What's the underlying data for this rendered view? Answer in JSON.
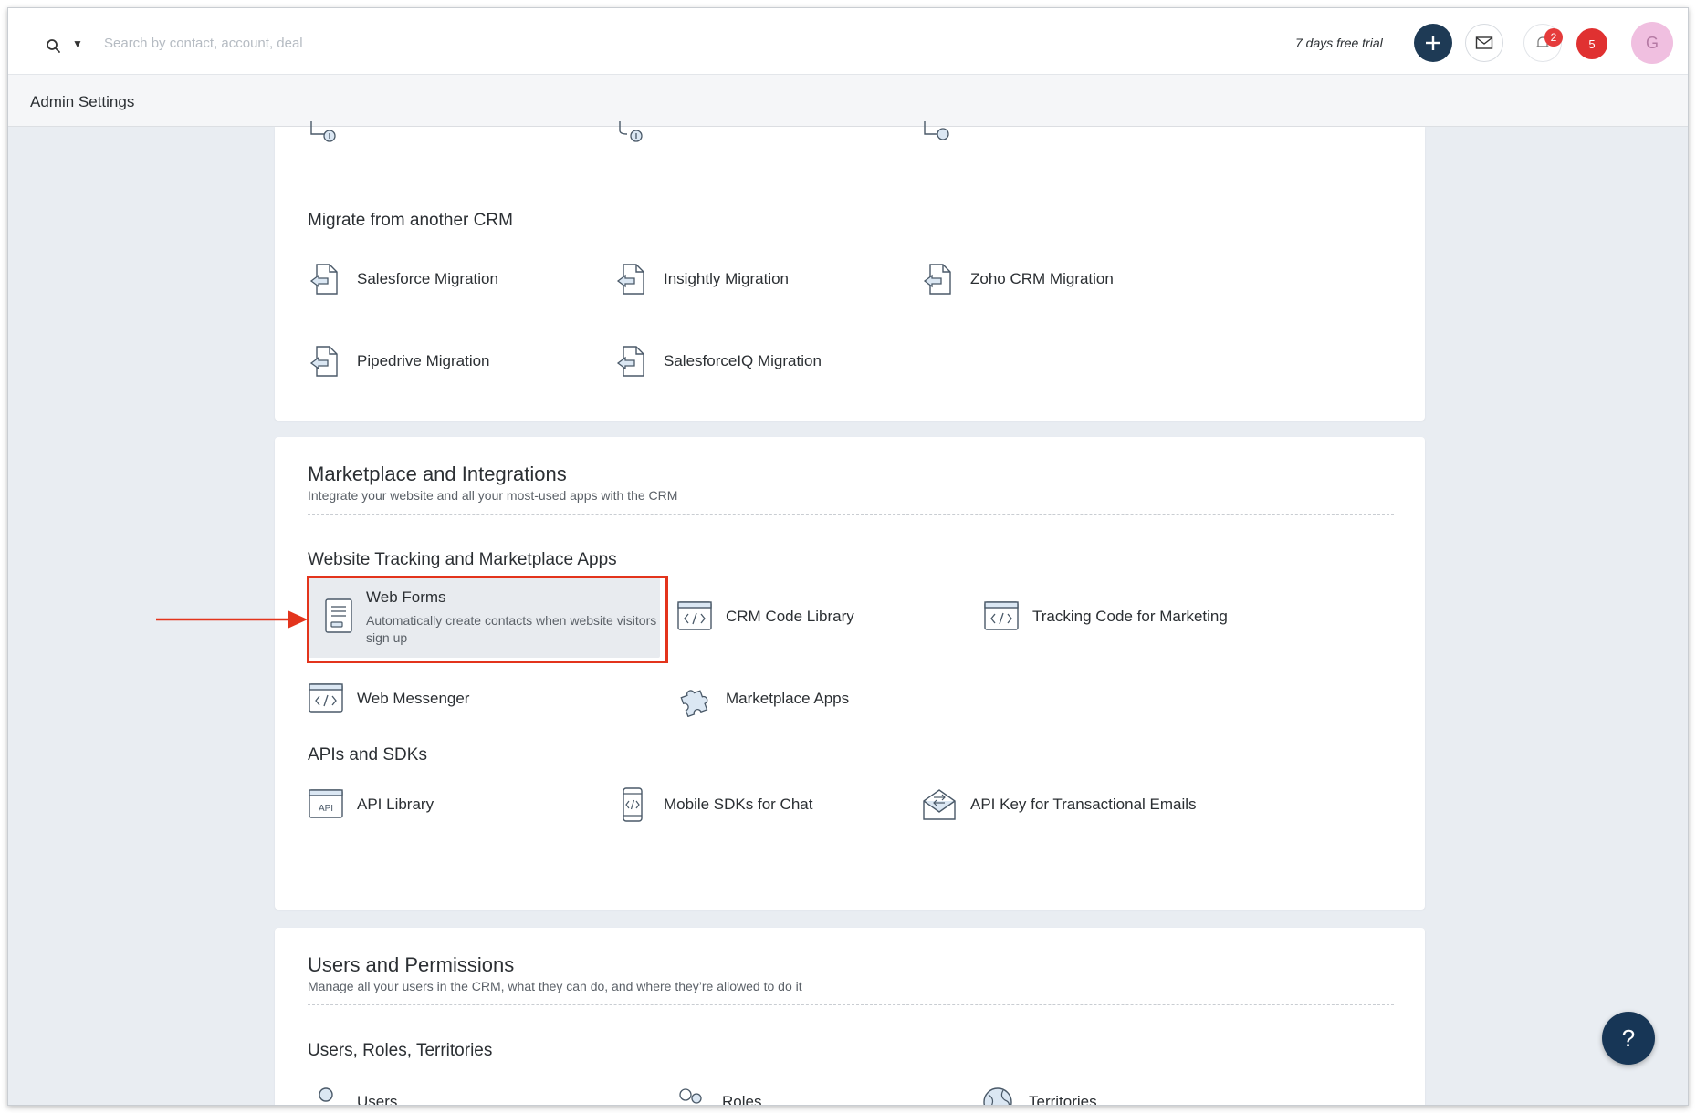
{
  "header": {
    "search_placeholder": "Search by contact, account, deal",
    "trial_text": "7 days free trial",
    "notification_count": "2",
    "alert_count": "5",
    "avatar_initial": "G"
  },
  "subbar": {
    "title": "Admin Settings"
  },
  "migrate": {
    "title": "Migrate from another CRM",
    "items": [
      {
        "label": "Salesforce Migration",
        "icon": "file-import-icon"
      },
      {
        "label": "Insightly Migration",
        "icon": "file-import-icon"
      },
      {
        "label": "Zoho CRM Migration",
        "icon": "file-import-icon"
      },
      {
        "label": "Pipedrive Migration",
        "icon": "file-import-icon"
      },
      {
        "label": "SalesforceIQ Migration",
        "icon": "file-import-icon"
      }
    ]
  },
  "marketplace": {
    "title": "Marketplace and Integrations",
    "description": "Integrate your website and all your most-used apps with the CRM",
    "tracking_group": {
      "title": "Website Tracking and Marketplace Apps",
      "web_forms": {
        "label": "Web Forms",
        "description": "Automatically create contacts when website visitors sign up"
      },
      "items": [
        {
          "label": "CRM Code Library",
          "icon": "code-window-icon"
        },
        {
          "label": "Tracking Code for Marketing",
          "icon": "code-window-icon"
        },
        {
          "label": "Web Messenger",
          "icon": "code-window-icon"
        },
        {
          "label": "Marketplace Apps",
          "icon": "puzzle-icon"
        }
      ]
    },
    "api_group": {
      "title": "APIs and SDKs",
      "items": [
        {
          "label": "API Library",
          "icon": "api-window-icon",
          "icon_text": "API"
        },
        {
          "label": "Mobile SDKs for Chat",
          "icon": "mobile-code-icon"
        },
        {
          "label": "API Key for Transactional Emails",
          "icon": "envelope-icon"
        }
      ]
    }
  },
  "users": {
    "title": "Users and Permissions",
    "description": "Manage all your users in the CRM, what they can do, and where they’re allowed to do it",
    "group": {
      "title": "Users, Roles, Territories",
      "items": [
        {
          "label": "Users",
          "icon": "user-icon"
        },
        {
          "label": "Roles",
          "icon": "users-icon"
        },
        {
          "label": "Territories",
          "icon": "globe-icon"
        }
      ]
    }
  },
  "help": {
    "label": "?"
  },
  "colors": {
    "accent_dark": "#1e3a55",
    "highlight": "#e3341c",
    "badge_red": "#e53b3b",
    "icon_blue": "#4a7fb5"
  }
}
